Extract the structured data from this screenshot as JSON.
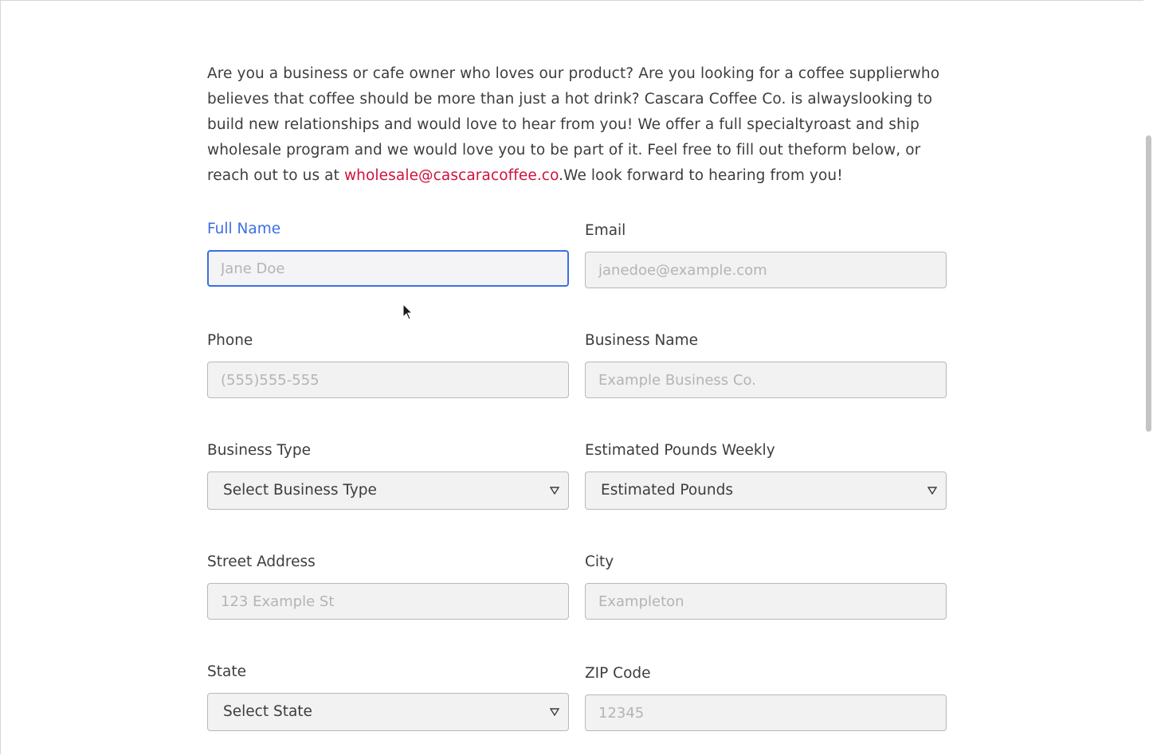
{
  "intro": {
    "text_before_email": "Are you a business or cafe owner who loves our product? Are you looking for a coffee supplierwho believes that coffee should be more than just a hot drink? Cascara Coffee Co. is alwayslooking to build new relationships and would love to hear from you! We offer a full specialtyroast and ship wholesale program and we would love you to be part of it. Feel free to fill out theform below, or reach out to us at ",
    "email": "wholesale@cascaracoffee.co",
    "text_after_email": ".We look forward to hearing from you!"
  },
  "form": {
    "full_name": {
      "label": "Full Name",
      "placeholder": "Jane Doe",
      "value": ""
    },
    "email": {
      "label": "Email",
      "placeholder": "janedoe@example.com",
      "value": ""
    },
    "phone": {
      "label": "Phone",
      "placeholder": "(555)555-555",
      "value": ""
    },
    "business_name": {
      "label": "Business Name",
      "placeholder": "Example Business Co.",
      "value": ""
    },
    "business_type": {
      "label": "Business Type",
      "selected": "Select Business Type"
    },
    "estimated_pounds": {
      "label": "Estimated Pounds Weekly",
      "selected": "Estimated Pounds"
    },
    "street_address": {
      "label": "Street Address",
      "placeholder": "123 Example St",
      "value": ""
    },
    "city": {
      "label": "City",
      "placeholder": "Exampleton",
      "value": ""
    },
    "state": {
      "label": "State",
      "selected": "Select State"
    },
    "zip": {
      "label": "ZIP Code",
      "placeholder": "12345",
      "value": ""
    }
  },
  "icons": {
    "select_arrow": "chevron-down-icon",
    "cursor": "mouse-pointer-icon"
  },
  "colors": {
    "focus_accent": "#3b6fe0",
    "link": "#d0113a",
    "text": "#3d3d3d",
    "field_bg": "#f2f2f3",
    "field_border": "#b8b8b8",
    "placeholder": "#b4b4b8"
  }
}
